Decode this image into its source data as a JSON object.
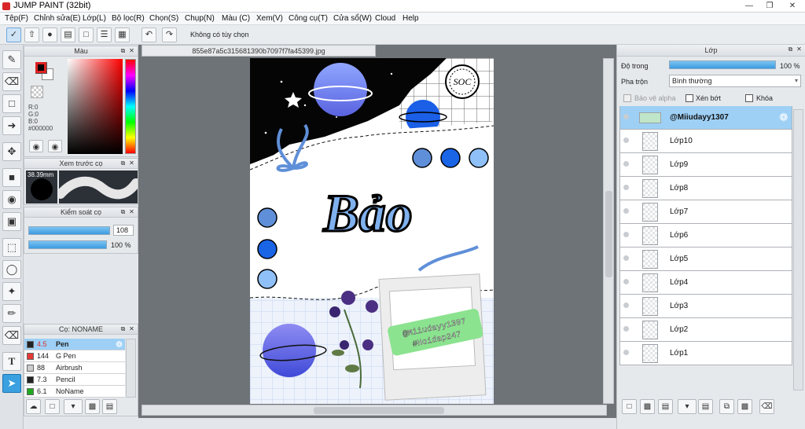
{
  "app": {
    "title": "JUMP PAINT (32bit)"
  },
  "menu": [
    "Tệp(F)",
    "Chỉnh sửa(E)",
    "Lớp(L)",
    "Bộ lọc(R)",
    "Chọn(S)",
    "Chụp(N)",
    "Màu (C)",
    "Xem(V)",
    "Công cụ(T)",
    "Cửa sổ(W)",
    "Cloud",
    "Help"
  ],
  "toolbar": {
    "selection_status": "Không có tùy chọn"
  },
  "color_panel": {
    "title": "Màu",
    "r": "R:0",
    "g": "G:0",
    "b": "B:0",
    "hex": "#000000",
    "fg": "#000000",
    "bg": "#ffffff"
  },
  "brush_preview": {
    "title": "Xem trước cọ",
    "size": "38.39mm"
  },
  "brush_control": {
    "title": "Kiểm soát cọ",
    "size_value": "108",
    "opacity_value": "100 %"
  },
  "brush_list": {
    "title": "Cọ: NONAME",
    "items": [
      {
        "size": "4.5",
        "name": "Pen",
        "color": "#222222"
      },
      {
        "size": "144",
        "name": "G Pen",
        "color": "#e53935"
      },
      {
        "size": "88",
        "name": "Airbrush",
        "color": "#cccccc"
      },
      {
        "size": "7.3",
        "name": "Pencil",
        "color": "#222222"
      },
      {
        "size": "6.1",
        "name": "NoName",
        "color": "#1faa1f"
      }
    ]
  },
  "document": {
    "tab_name": "855e87a5c315681390b7097f7fa45399.jpg"
  },
  "artwork": {
    "title_text": "Bảo",
    "stamp": "SOC",
    "line1": "@Miiudayy1307",
    "line2": "#Hoidap247"
  },
  "layer_panel": {
    "title": "Lớp",
    "opacity_label": "Độ trong",
    "opacity_value": "100 %",
    "blend_label": "Pha trộn",
    "blend_value": "Bình thường",
    "alpha_label": "Bảo vệ alpha",
    "clip_label": "Xén bớt",
    "lock_label": "Khóa",
    "layers": [
      "@Miiudayy1307",
      "Lớp10",
      "Lớp9",
      "Lớp8",
      "Lớp7",
      "Lớp6",
      "Lớp5",
      "Lớp4",
      "Lớp3",
      "Lớp2",
      "Lớp1"
    ]
  }
}
